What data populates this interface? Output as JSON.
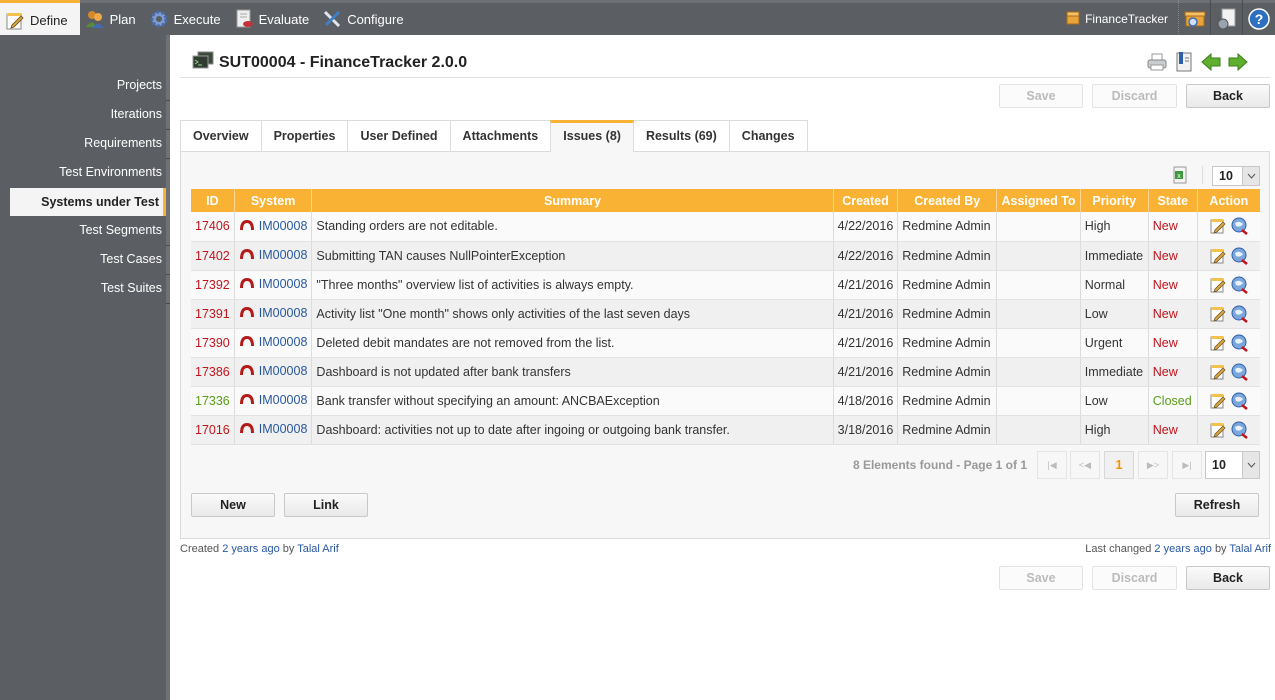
{
  "topbar": {
    "menu": [
      {
        "label": "Define",
        "icon": "notepad-pencil-icon",
        "active": true
      },
      {
        "label": "Plan",
        "icon": "people-icon",
        "active": false
      },
      {
        "label": "Execute",
        "icon": "gear-icon",
        "active": false
      },
      {
        "label": "Evaluate",
        "icon": "report-chart-icon",
        "active": false
      },
      {
        "label": "Configure",
        "icon": "wrench-screwdriver-icon",
        "active": false
      }
    ],
    "project_label": "FinanceTracker",
    "project_icon": "box-icon",
    "right_icons": [
      "project-search-icon",
      "report-schedule-icon",
      "help-icon"
    ]
  },
  "sidebar": {
    "items": [
      {
        "label": "Projects",
        "active": false
      },
      {
        "label": "Iterations",
        "active": false
      },
      {
        "label": "Requirements",
        "active": false
      },
      {
        "label": "Test Environments",
        "active": false
      },
      {
        "label": "Systems under Test",
        "active": true
      },
      {
        "label": "Test Segments",
        "active": false
      },
      {
        "label": "Test Cases",
        "active": false
      },
      {
        "label": "Test Suites",
        "active": false
      }
    ]
  },
  "header": {
    "title": "SUT00004 - FinanceTracker 2.0.0",
    "icons": [
      "print-icon",
      "bookmark-document-icon",
      "previous-arrow-icon",
      "next-arrow-icon"
    ]
  },
  "actions": {
    "save": "Save",
    "discard": "Discard",
    "back": "Back"
  },
  "tabs": [
    {
      "label": "Overview",
      "active": false
    },
    {
      "label": "Properties",
      "active": false
    },
    {
      "label": "User Defined",
      "active": false
    },
    {
      "label": "Attachments",
      "active": false
    },
    {
      "label": "Issues (8)",
      "active": true
    },
    {
      "label": "Results (69)",
      "active": false
    },
    {
      "label": "Changes",
      "active": false
    }
  ],
  "issues": {
    "page_size_top": "10",
    "columns": [
      "ID",
      "System",
      "Summary",
      "Created",
      "Created By",
      "Assigned To",
      "Priority",
      "State",
      "Action"
    ],
    "rows": [
      {
        "id": "17406",
        "system": "IM00008",
        "summary": "Standing orders are not editable.",
        "created": "4/22/2016",
        "created_by": "Redmine Admin",
        "assigned_to": "",
        "priority": "High",
        "state": "New"
      },
      {
        "id": "17402",
        "system": "IM00008",
        "summary": "Submitting TAN causes NullPointerException",
        "created": "4/22/2016",
        "created_by": "Redmine Admin",
        "assigned_to": "",
        "priority": "Immediate",
        "state": "New"
      },
      {
        "id": "17392",
        "system": "IM00008",
        "summary": "\"Three months\" overview list of activities is always empty.",
        "created": "4/21/2016",
        "created_by": "Redmine Admin",
        "assigned_to": "",
        "priority": "Normal",
        "state": "New"
      },
      {
        "id": "17391",
        "system": "IM00008",
        "summary": "Activity list \"One month\" shows only activities of the last seven days",
        "created": "4/21/2016",
        "created_by": "Redmine Admin",
        "assigned_to": "",
        "priority": "Low",
        "state": "New"
      },
      {
        "id": "17390",
        "system": "IM00008",
        "summary": "Deleted debit mandates are not removed from the list.",
        "created": "4/21/2016",
        "created_by": "Redmine Admin",
        "assigned_to": "",
        "priority": "Urgent",
        "state": "New"
      },
      {
        "id": "17386",
        "system": "IM00008",
        "summary": "Dashboard is not updated after bank transfers",
        "created": "4/21/2016",
        "created_by": "Redmine Admin",
        "assigned_to": "",
        "priority": "Immediate",
        "state": "New"
      },
      {
        "id": "17336",
        "system": "IM00008",
        "summary": "Bank transfer without specifying an amount: ANCBAException",
        "created": "4/18/2016",
        "created_by": "Redmine Admin",
        "assigned_to": "",
        "priority": "Low",
        "state": "Closed"
      },
      {
        "id": "17016",
        "system": "IM00008",
        "summary": "Dashboard: activities not up to date after ingoing or outgoing bank transfer.",
        "created": "3/18/2016",
        "created_by": "Redmine Admin",
        "assigned_to": "",
        "priority": "High",
        "state": "New"
      }
    ],
    "pager": {
      "info": "8 Elements found - Page 1 of 1",
      "first": "|◀",
      "prev": "<◀",
      "current": "1",
      "next": "▶>",
      "last": "▶|",
      "page_size": "10"
    },
    "new_label": "New",
    "link_label": "Link",
    "refresh_label": "Refresh"
  },
  "footer": {
    "created_prefix": "Created",
    "created_ago": "2 years ago",
    "created_by_word": "by",
    "created_user": "Talal Arif",
    "changed_prefix": "Last changed",
    "changed_ago": "2 years ago",
    "changed_by_word": "by",
    "changed_user": "Talal Arif"
  },
  "colors": {
    "accent": "#f9b233",
    "chrome": "#5b5e62",
    "state_new": "#c0141c",
    "state_closed": "#5a9e1a",
    "link": "#2858a0"
  }
}
